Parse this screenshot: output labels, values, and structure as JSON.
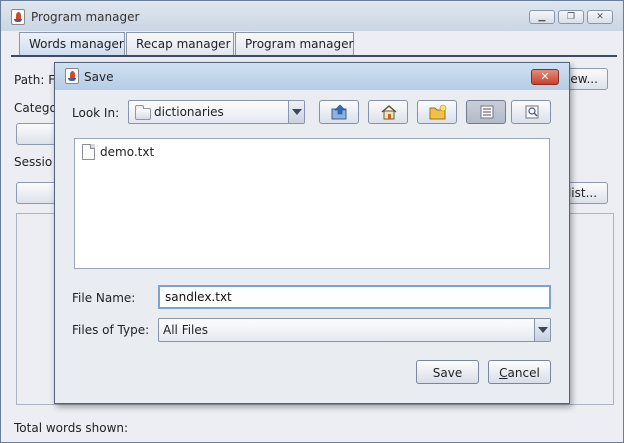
{
  "main_window": {
    "title": "Program manager",
    "controls": {
      "minimize": "▁",
      "maximize": "❐",
      "close": "✕"
    },
    "tabs": [
      {
        "label": "Words manager",
        "active": true
      },
      {
        "label": "Recap manager",
        "active": false
      },
      {
        "label": "Program manager",
        "active": false
      }
    ],
    "path_label": "Path: F:",
    "view_button_fragment": "iew...",
    "category_label": "Catego",
    "session_label": "Sessio",
    "list_button_fragment": "list...",
    "total_words_label": "Total words shown:"
  },
  "dialog": {
    "title": "Save",
    "close_glyph": "✕",
    "look_in_label": "Look In:",
    "look_in_value": "dictionaries",
    "toolbar": [
      "up-one-level",
      "home",
      "new-folder",
      "list-view",
      "details-view"
    ],
    "files": [
      {
        "name": "demo.txt"
      }
    ],
    "file_name_label": "File Name:",
    "file_name_value": "sandlex.txt",
    "files_of_type_label": "Files of Type:",
    "files_of_type_value": "All Files",
    "save_label": "Save",
    "cancel_label_first": "C",
    "cancel_label_rest": "ancel"
  },
  "colors": {
    "title_bar": "#c6d4e6",
    "close_button": "#c94a34",
    "focus_border": "#7aa2d2"
  }
}
